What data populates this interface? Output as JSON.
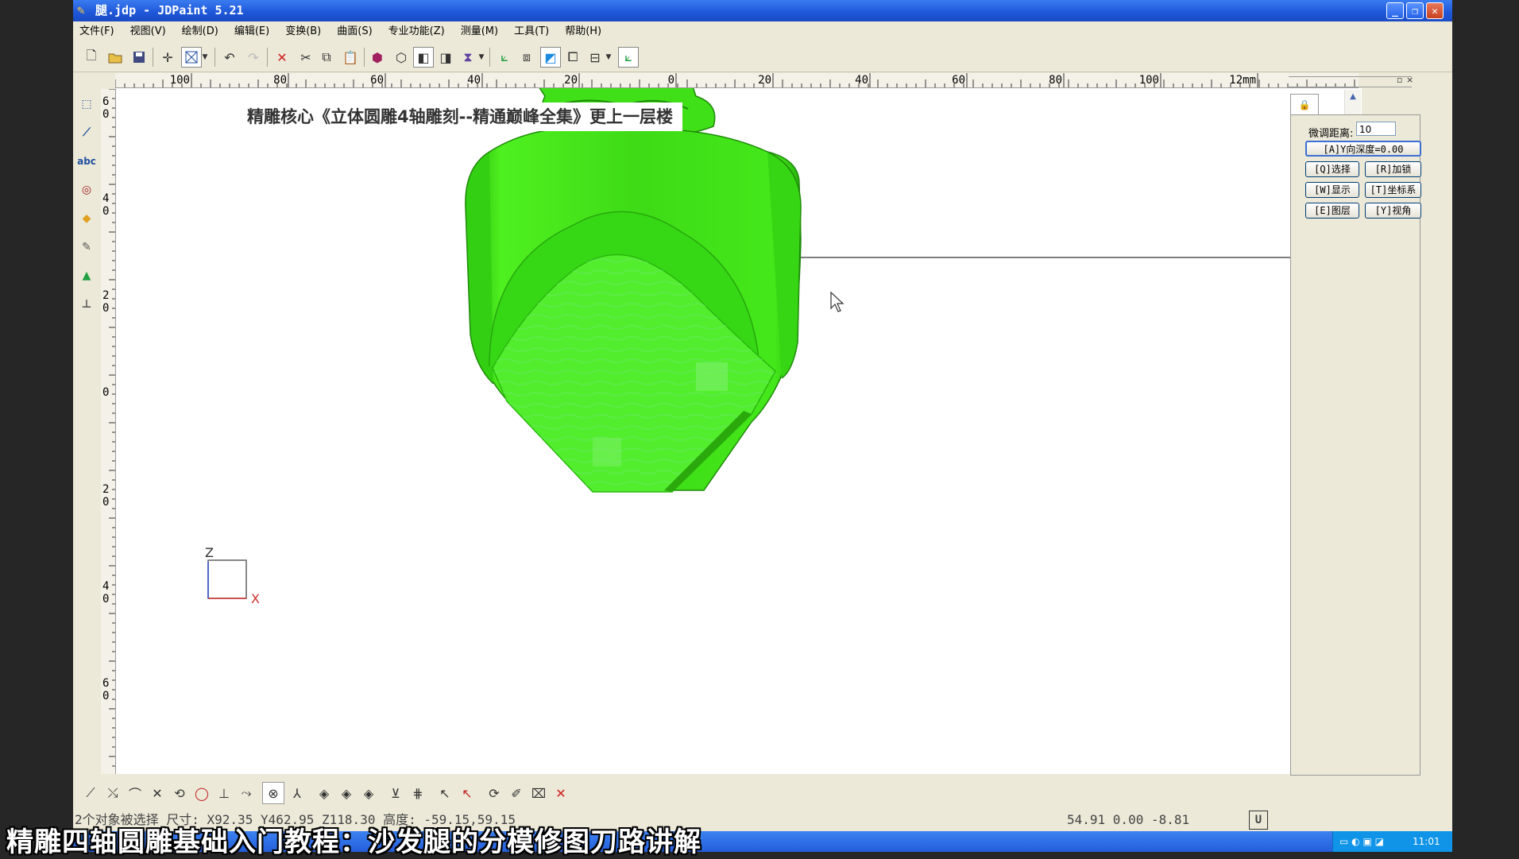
{
  "window": {
    "title": "腿.jdp - JDPaint 5.21",
    "controls": {
      "minimize": "_",
      "restore": "❐",
      "close": "✕"
    }
  },
  "menu": [
    "文件(F)",
    "视图(V)",
    "绘制(D)",
    "编辑(E)",
    "变换(B)",
    "曲面(S)",
    "专业功能(Z)",
    "测量(M)",
    "工具(T)",
    "帮助(H)"
  ],
  "ruler": {
    "horizontal": [
      "100",
      "80",
      "60",
      "40",
      "20",
      "0",
      "20",
      "40",
      "60",
      "80",
      "100",
      "12mm"
    ],
    "vertical": [
      "60",
      "40",
      "20",
      "0",
      "20",
      "40",
      "60"
    ]
  },
  "viewport": {
    "banner": "精雕核心《立体圆雕4轴雕刻--精通巅峰全集》更上一层楼",
    "axis": {
      "z": "Z",
      "x": "X"
    }
  },
  "panel": {
    "tab_icon": "lock-icon",
    "nudge_label": "微调距离:",
    "nudge_value": "10",
    "depth_button": "[A]Y向深度=0.00",
    "buttons": [
      "[Q]选择",
      "[R]加锁",
      "[W]显示",
      "[T]坐标系",
      "[E]图层",
      "[Y]视角"
    ]
  },
  "palette": [
    "#ff2020",
    "#ffff20",
    "#2040ff",
    "#20e020",
    "#20e8e8",
    "#ff20ff",
    "#ffffff",
    "#202020",
    "#c8c8c8",
    "#f08030",
    "#e04040",
    "#f8c0c0",
    "#40c080",
    "#40a0a0",
    "#f0d020",
    "#f0a050",
    "#a0a030",
    "#c02020",
    "#2030a0",
    "#20a030",
    "#20a0a0",
    "#c020a0",
    "#6020a0",
    "#80a0e0",
    "#a0a0a0"
  ],
  "status": {
    "selection": "2个对象被选择 尺寸: X92.35 Y462.95 Z118.30 高度: -59.15,59.15",
    "coords": "54.91 0.00 -8.81",
    "unit_button": "U"
  },
  "taskbar": {
    "clock": "11:01"
  },
  "subtitle": "精雕四轴圆雕基础入门教程：沙发腿的分模修图刀路讲解"
}
